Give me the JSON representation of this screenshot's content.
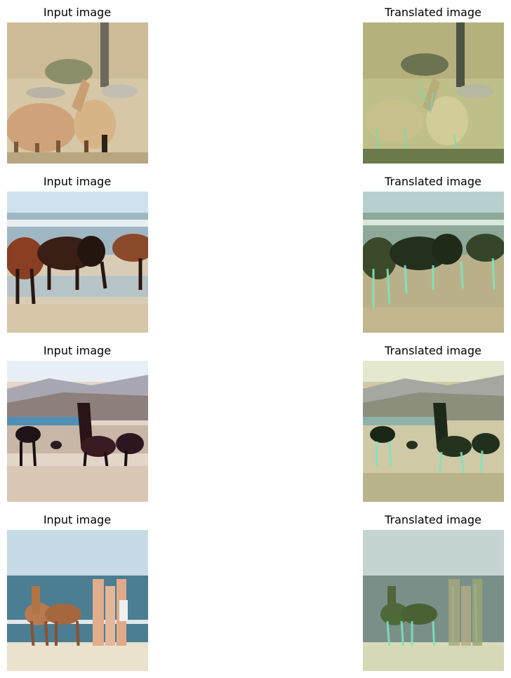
{
  "panels": [
    {
      "input_title": "Input image",
      "output_title": "Translated image"
    },
    {
      "input_title": "Input image",
      "output_title": "Translated image"
    },
    {
      "input_title": "Input image",
      "output_title": "Translated image"
    },
    {
      "input_title": "Input image",
      "output_title": "Translated image"
    }
  ],
  "colors": {
    "background": "#ffffff",
    "sand": "#d9c8a8",
    "sky_blue": "#cfe0ea",
    "sea_blue": "#5b8fa8",
    "horse_tan": "#caa676",
    "horse_brown": "#7a3a20",
    "horse_dark": "#2a1a14",
    "translated_green": "#3e5a32",
    "translated_teal": "#8fe0c0"
  }
}
